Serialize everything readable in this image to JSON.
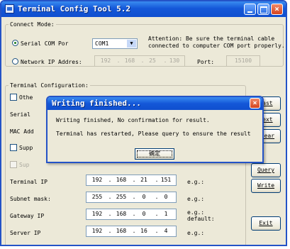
{
  "window": {
    "title": "Terminal Config Tool 5.2"
  },
  "connect": {
    "legend": "Connect Mode:",
    "serial_label": "Serial COM Por",
    "com_value": "COM1",
    "attention": "Attention: Be sure the terminal cable",
    "attention2": "connected to computer COM port properly.",
    "network_label": "Network IP Addres:",
    "network_ip": [
      "192",
      "168",
      "25",
      "130"
    ],
    "port_label": "Port:",
    "port_value": "15100"
  },
  "config": {
    "legend": "Terminal Configuration:",
    "other_label": "Othe",
    "serial_label": "Serial",
    "mac_label": "MAC Add",
    "supp1": "Supp",
    "supp2": "Sup",
    "terminal_ip_label": "Terminal IP",
    "terminal_ip": [
      "192",
      "168",
      "21",
      "151"
    ],
    "terminal_eg": "e.g.:",
    "subnet_label": "Subnet mask:",
    "subnet": [
      "255",
      "255",
      "0",
      "0"
    ],
    "subnet_eg": "e.g.:",
    "gateway_label": "Gateway IP",
    "gateway": [
      "192",
      "168",
      "0",
      "1"
    ],
    "gateway_eg": "e.g.:",
    "gateway_default": "default:",
    "server_label": "Server IP",
    "server": [
      "192",
      "168",
      "16",
      "4"
    ],
    "server_eg": "e.g.:"
  },
  "buttons": {
    "last": "Last",
    "next": "Next",
    "clear": "Clear",
    "query": "Query",
    "write": "Write",
    "exit": "Exit"
  },
  "dialog": {
    "title": "Writing finished...",
    "line1": "Writing finished, No confirmation for result.",
    "line2": "Terminal has restarted, Please query to ensure the result",
    "ok": "确定"
  }
}
